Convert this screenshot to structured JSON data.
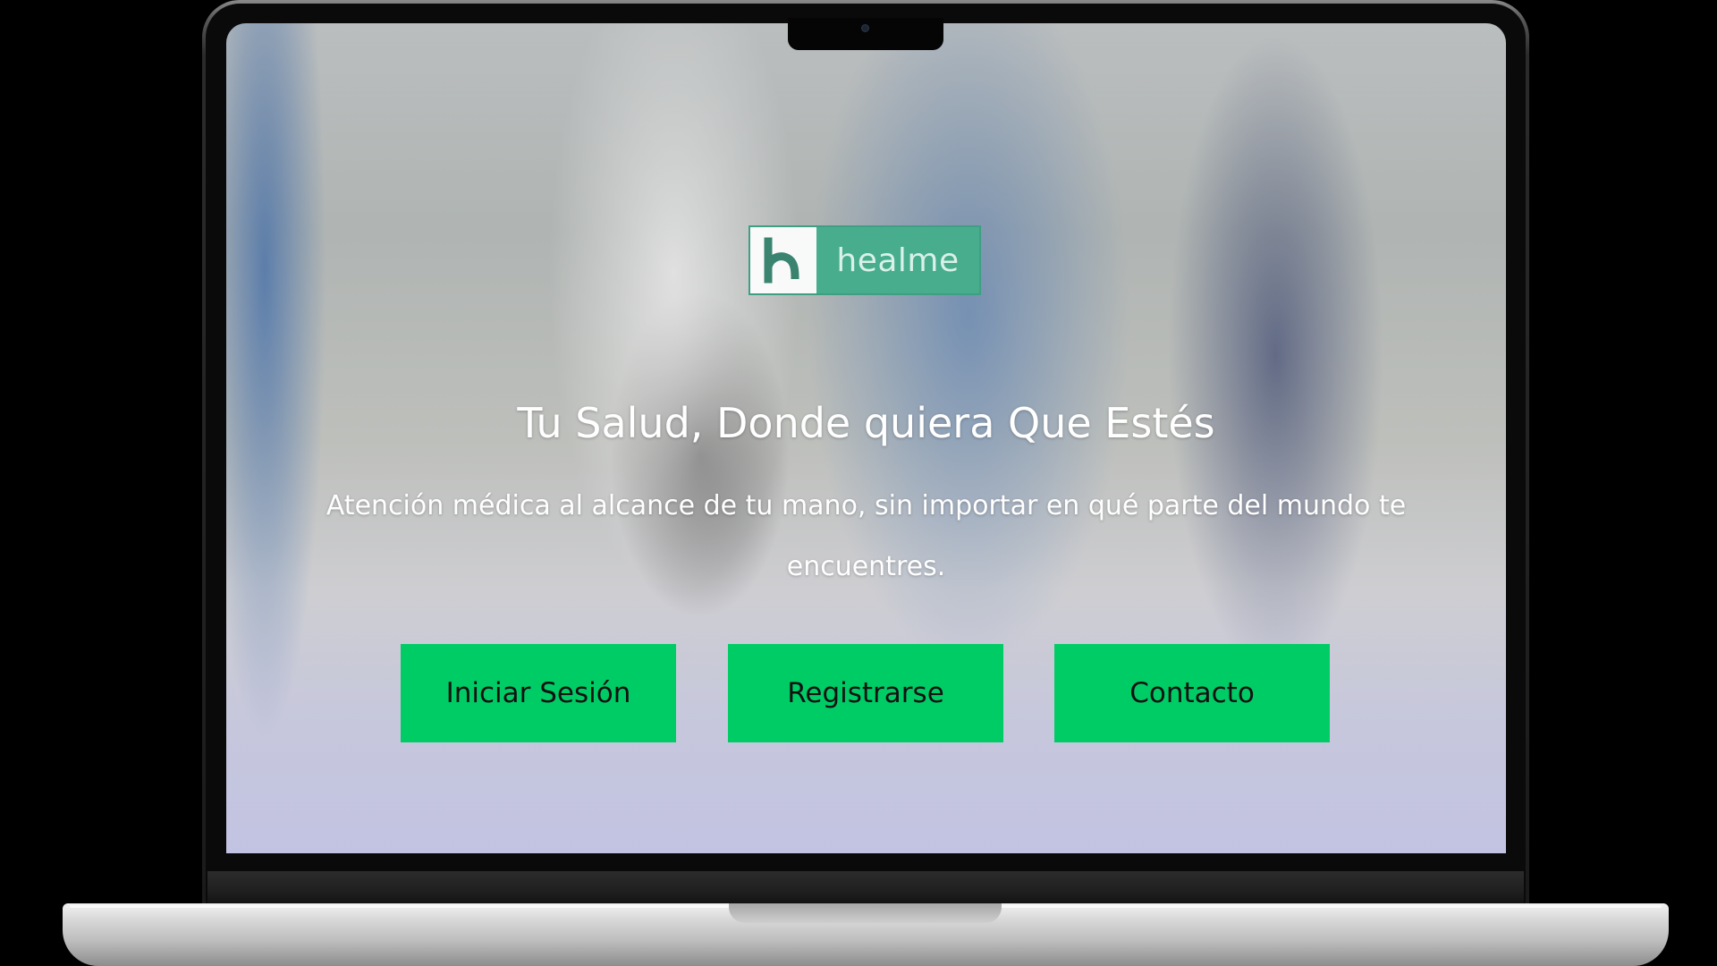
{
  "app": {
    "logo_text": "healme",
    "logo_mark_icon": "letter-h-logo-icon",
    "brand_color": "#48ad8d"
  },
  "hero": {
    "headline": "Tu Salud, Donde quiera Que Estés",
    "subtitle": "Atención médica al alcance de tu mano, sin importar en qué parte del mundo te encuentres."
  },
  "actions": {
    "login_label": "Iniciar Sesión",
    "register_label": "Registrarse",
    "contact_label": "Contacto",
    "button_color": "#00cc66"
  }
}
